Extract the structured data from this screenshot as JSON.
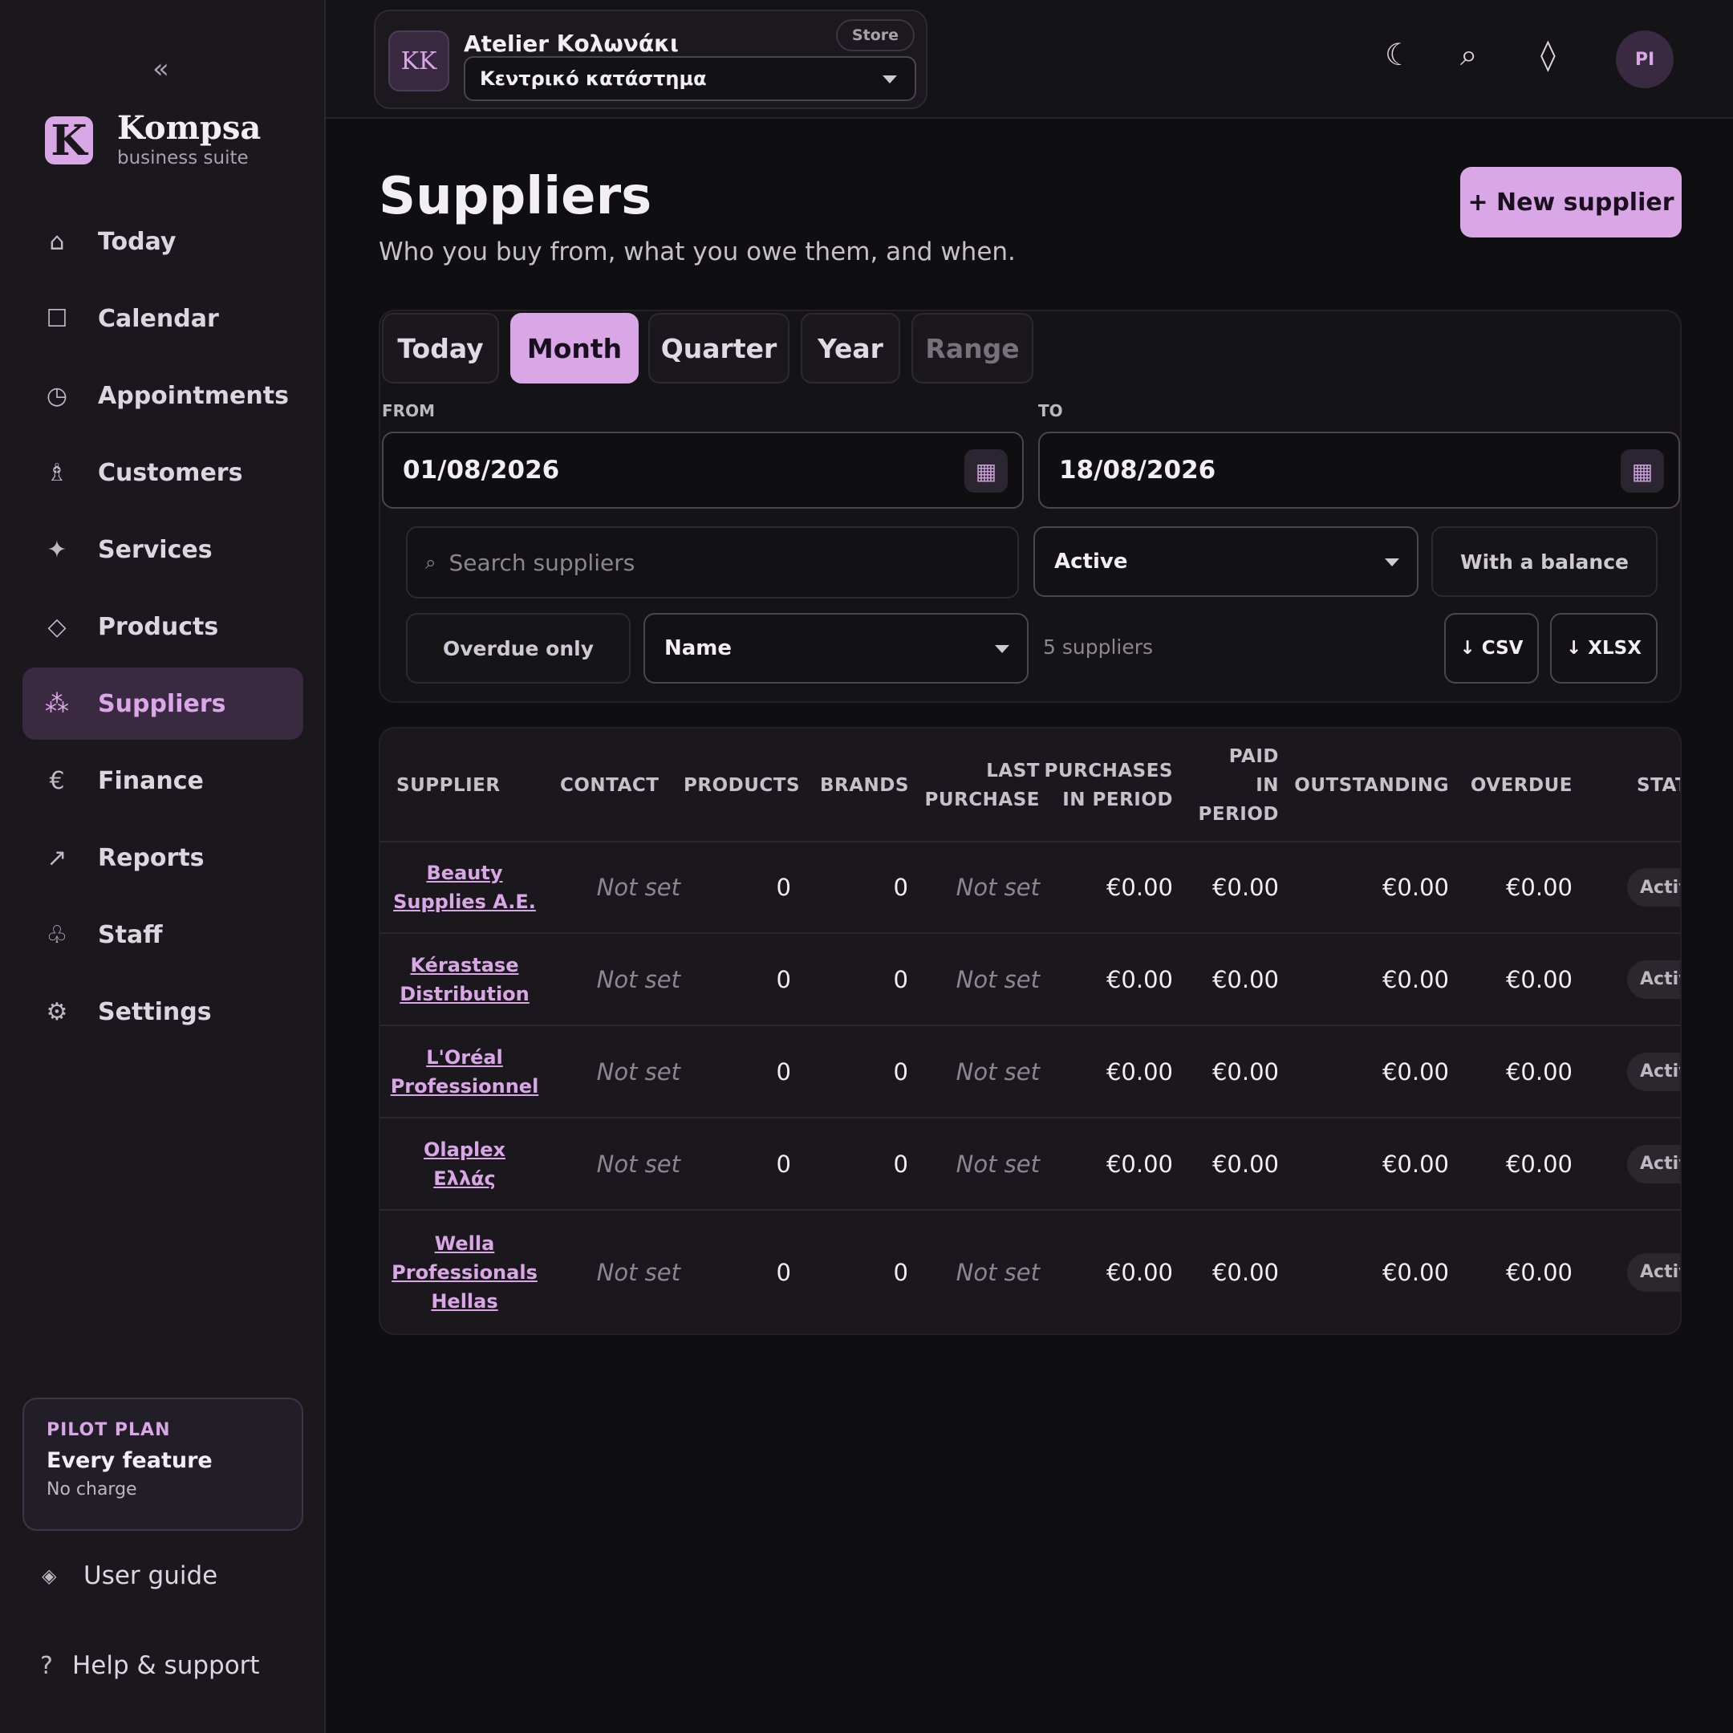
{
  "sidebar": {
    "collapse_label": "«",
    "brand": {
      "logo_letter": "K",
      "name": "Kompsa",
      "tagline": "business suite"
    },
    "items": [
      {
        "label": "Today",
        "icon": "home-icon",
        "glyph": "⌂"
      },
      {
        "label": "Calendar",
        "icon": "calendar-icon",
        "glyph": "☐"
      },
      {
        "label": "Appointments",
        "icon": "clock-icon",
        "glyph": "◷"
      },
      {
        "label": "Customers",
        "icon": "person-icon",
        "glyph": "♗"
      },
      {
        "label": "Services",
        "icon": "sparkle-icon",
        "glyph": "✦"
      },
      {
        "label": "Products",
        "icon": "diamond-icon",
        "glyph": "◇"
      },
      {
        "label": "Suppliers",
        "icon": "people-icon",
        "glyph": "⁂"
      },
      {
        "label": "Finance",
        "icon": "euro-icon",
        "glyph": "€"
      },
      {
        "label": "Reports",
        "icon": "arrow-up-right-icon",
        "glyph": "↗"
      },
      {
        "label": "Staff",
        "icon": "club-icon",
        "glyph": "♧"
      },
      {
        "label": "Settings",
        "icon": "gear-icon",
        "glyph": "⚙"
      }
    ],
    "active_item": "Suppliers",
    "plan": {
      "kicker": "PILOT PLAN",
      "title": "Every feature",
      "subtitle": "No charge"
    },
    "user_guide": {
      "label": "User guide",
      "glyph": "◈"
    },
    "help": {
      "label": "Help & support",
      "glyph": "?"
    }
  },
  "topbar": {
    "store": {
      "initials": "KK",
      "name": "Atelier Κολωνάκι",
      "badge": "Store",
      "location": "Κεντρικό κατάστημα"
    },
    "icons": {
      "theme": "☾",
      "search": "⌕",
      "gem": "◊"
    },
    "user_initials": "PI"
  },
  "page": {
    "title": "Suppliers",
    "subtitle": "Who you buy from, what you owe them, and when.",
    "new_button": "+ New supplier"
  },
  "filters": {
    "periods": [
      {
        "label": "Today",
        "state": "normal"
      },
      {
        "label": "Month",
        "state": "active"
      },
      {
        "label": "Quarter",
        "state": "normal"
      },
      {
        "label": "Year",
        "state": "normal"
      },
      {
        "label": "Range",
        "state": "disabled"
      }
    ],
    "from_label": "FROM",
    "from_value": "01/08/2026",
    "to_label": "TO",
    "to_value": "18/08/2026",
    "calendar_glyph": "▦",
    "search_glyph": "⌕",
    "search_placeholder": "Search suppliers",
    "status_value": "Active",
    "balance_button": "With a balance",
    "overdue_button": "Overdue only",
    "sort_value": "Name",
    "count_text": "5 suppliers",
    "csv_button": "↓ CSV",
    "xlsx_button": "↓ XLSX"
  },
  "table": {
    "headers": {
      "supplier": "SUPPLIER",
      "contact": "CONTACT",
      "products": "PRODUCTS",
      "brands": "BRANDS",
      "last_purchase": "LAST\nPURCHASE",
      "purchases": "PURCHASES\nIN PERIOD",
      "paid": "PAID\nIN\nPERIOD",
      "outstanding": "OUTSTANDING",
      "overdue": "OVERDUE",
      "status": "STAT"
    },
    "rows": [
      {
        "supplier": "Beauty\nSupplies A.E.",
        "contact": "Not set",
        "products": "0",
        "brands": "0",
        "last_purchase": "Not set",
        "purchases": "€0.00",
        "paid": "€0.00",
        "outstanding": "€0.00",
        "overdue": "€0.00",
        "status": "Activ"
      },
      {
        "supplier": "Kérastase\nDistribution",
        "contact": "Not set",
        "products": "0",
        "brands": "0",
        "last_purchase": "Not set",
        "purchases": "€0.00",
        "paid": "€0.00",
        "outstanding": "€0.00",
        "overdue": "€0.00",
        "status": "Activ"
      },
      {
        "supplier": "L'Oréal\nProfessionnel",
        "contact": "Not set",
        "products": "0",
        "brands": "0",
        "last_purchase": "Not set",
        "purchases": "€0.00",
        "paid": "€0.00",
        "outstanding": "€0.00",
        "overdue": "€0.00",
        "status": "Activ"
      },
      {
        "supplier": "Olaplex\nΕλλάς",
        "contact": "Not set",
        "products": "0",
        "brands": "0",
        "last_purchase": "Not set",
        "purchases": "€0.00",
        "paid": "€0.00",
        "outstanding": "€0.00",
        "overdue": "€0.00",
        "status": "Activ"
      },
      {
        "supplier": "Wella\nProfessionals\nHellas",
        "contact": "Not set",
        "products": "0",
        "brands": "0",
        "last_purchase": "Not set",
        "purchases": "€0.00",
        "paid": "€0.00",
        "outstanding": "€0.00",
        "overdue": "€0.00",
        "status": "Activ"
      }
    ]
  },
  "colors": {
    "accent": "#d9a6e6",
    "background": "#0f0e10",
    "sidebar": "#1a181c",
    "active_nav": "#3a2a41"
  }
}
